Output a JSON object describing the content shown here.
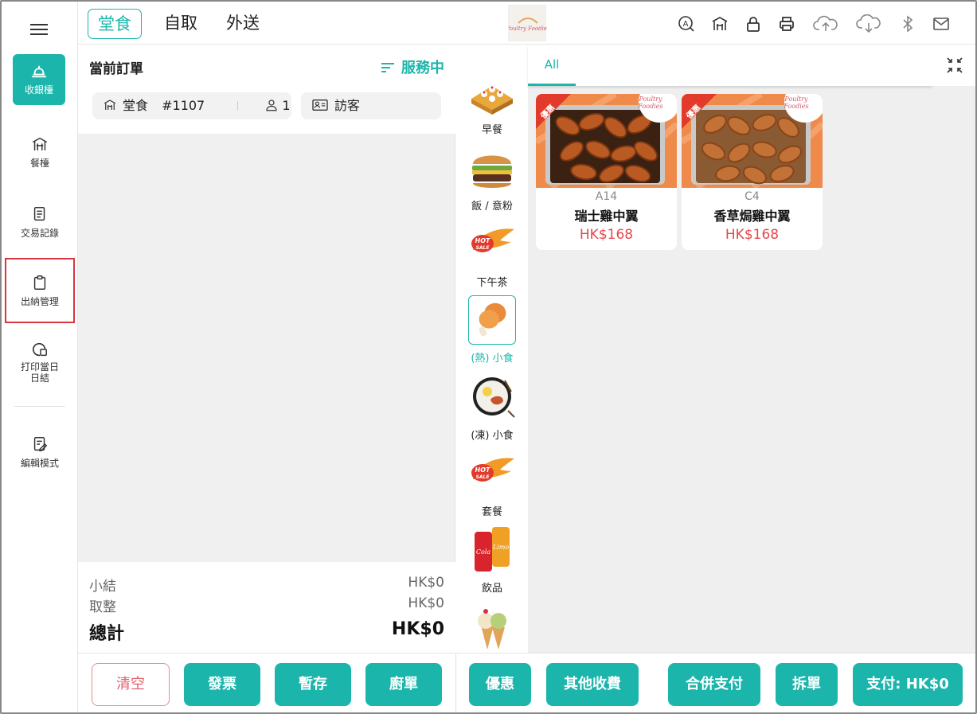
{
  "nav": {
    "items": [
      {
        "label": "收銀檯",
        "icon": "bell-icon"
      },
      {
        "label": "餐檯",
        "icon": "table-icon"
      },
      {
        "label": "交易記錄",
        "icon": "document-icon"
      },
      {
        "label": "出納管理",
        "icon": "clipboard-icon"
      },
      {
        "label": "打印當日日結",
        "icon": "print-report-icon"
      },
      {
        "label": "編輯模式",
        "icon": "edit-icon"
      }
    ]
  },
  "topbar": {
    "tabs": [
      "堂食",
      "自取",
      "外送"
    ],
    "active_tab": "堂食",
    "logo_text": "Poultry Foodies"
  },
  "order": {
    "title": "當前訂單",
    "status": "服務中",
    "mode": "堂食",
    "number": "#1107",
    "guests": "1",
    "customer": "訪客",
    "subtotal_label": "小結",
    "subtotal_value": "HK$0",
    "rounding_label": "取整",
    "rounding_value": "HK$0",
    "total_label": "總計",
    "total_value": "HK$0"
  },
  "categories": [
    {
      "label": "早餐",
      "active": false
    },
    {
      "label": "飯 / 意粉",
      "active": false
    },
    {
      "label": "下午茶",
      "active": false
    },
    {
      "label": "(熱) 小食",
      "active": true
    },
    {
      "label": "(凍) 小食",
      "active": false
    },
    {
      "label": "套餐",
      "active": false
    },
    {
      "label": "飲品",
      "active": false
    }
  ],
  "products": {
    "tab": "All",
    "items": [
      {
        "code": "A14",
        "name": "瑞士雞中翼",
        "price": "HK$168",
        "badge": "優惠",
        "brand": "Poultry Foodies"
      },
      {
        "code": "C4",
        "name": "香草焗雞中翼",
        "price": "HK$168",
        "badge": "優惠",
        "brand": "Poultry Foodies"
      }
    ]
  },
  "actions": {
    "clear": "清空",
    "invoice": "發票",
    "hold": "暫存",
    "kitchen": "廚單",
    "discount": "優惠",
    "other_charge": "其他收費",
    "merge_pay": "合併支付",
    "split": "拆單",
    "pay": "支付: HK$0"
  },
  "colors": {
    "accent": "#1cb5ab",
    "price": "#e5484d",
    "highlight_border": "#d9363e"
  }
}
